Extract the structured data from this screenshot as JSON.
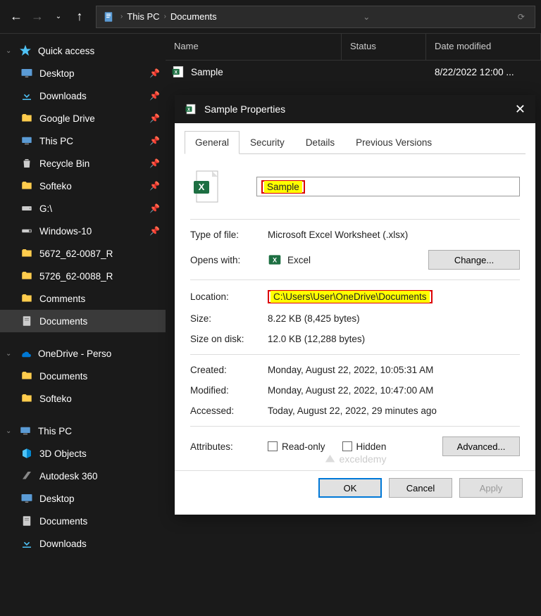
{
  "breadcrumb": {
    "parts": [
      "This PC",
      "Documents"
    ]
  },
  "sidebar": {
    "quick_access": "Quick access",
    "items": [
      {
        "label": "Desktop",
        "icon": "desktop",
        "pinned": true
      },
      {
        "label": "Downloads",
        "icon": "downloads",
        "pinned": true
      },
      {
        "label": "Google Drive",
        "icon": "folder",
        "pinned": true
      },
      {
        "label": "This PC",
        "icon": "thispc",
        "pinned": true
      },
      {
        "label": "Recycle Bin",
        "icon": "recycle",
        "pinned": true
      },
      {
        "label": "Softeko",
        "icon": "folder",
        "pinned": true
      },
      {
        "label": "G:\\",
        "icon": "drive",
        "pinned": true
      },
      {
        "label": "Windows-10",
        "icon": "usb",
        "pinned": true
      },
      {
        "label": "5672_62-0087_R",
        "icon": "folder",
        "pinned": false
      },
      {
        "label": "5726_62-0088_R",
        "icon": "folder",
        "pinned": false
      },
      {
        "label": "Comments",
        "icon": "folder",
        "pinned": false
      },
      {
        "label": "Documents",
        "icon": "documents",
        "pinned": false
      }
    ],
    "onedrive": "OneDrive - Perso",
    "od_items": [
      {
        "label": "Documents"
      },
      {
        "label": "Softeko"
      }
    ],
    "thispc": "This PC",
    "pc_items": [
      {
        "label": "3D Objects",
        "icon": "3d"
      },
      {
        "label": "Autodesk 360",
        "icon": "autodesk"
      },
      {
        "label": "Desktop",
        "icon": "desktop"
      },
      {
        "label": "Documents",
        "icon": "documents"
      },
      {
        "label": "Downloads",
        "icon": "downloads"
      }
    ]
  },
  "filelist": {
    "cols": {
      "name": "Name",
      "status": "Status",
      "modified": "Date modified"
    },
    "rows": [
      {
        "name": "Sample",
        "modified": "8/22/2022 12:00 ..."
      }
    ]
  },
  "dialog": {
    "title": "Sample Properties",
    "tabs": {
      "general": "General",
      "security": "Security",
      "details": "Details",
      "previous": "Previous Versions"
    },
    "filename": "Sample",
    "type_label": "Type of file:",
    "type_value": "Microsoft Excel Worksheet (.xlsx)",
    "opens_label": "Opens with:",
    "opens_value": "Excel",
    "change": "Change...",
    "location_label": "Location:",
    "location_value": "C:\\Users\\User\\OneDrive\\Documents",
    "size_label": "Size:",
    "size_value": "8.22 KB (8,425 bytes)",
    "disk_label": "Size on disk:",
    "disk_value": "12.0 KB (12,288 bytes)",
    "created_label": "Created:",
    "created_value": "Monday, August 22, 2022, 10:05:31 AM",
    "modified_label": "Modified:",
    "modified_value": "Monday, August 22, 2022, 10:47:00 AM",
    "accessed_label": "Accessed:",
    "accessed_value": "Today, August 22, 2022, 29 minutes ago",
    "attributes_label": "Attributes:",
    "readonly": "Read-only",
    "hidden": "Hidden",
    "advanced": "Advanced...",
    "ok": "OK",
    "cancel": "Cancel",
    "apply": "Apply"
  },
  "watermark": "exceldemy"
}
